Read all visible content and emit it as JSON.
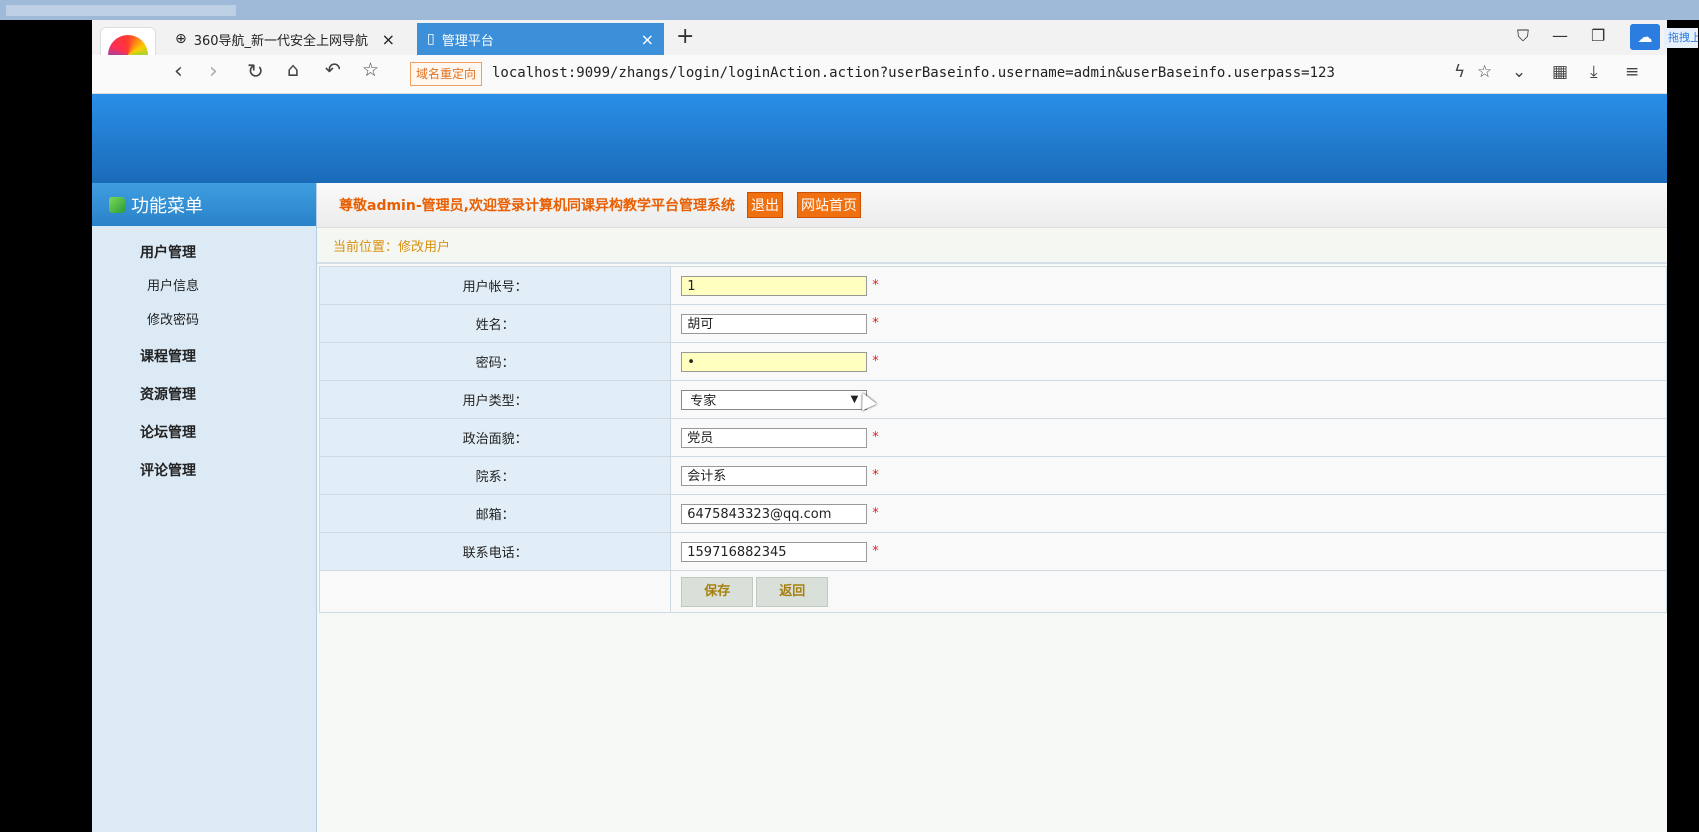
{
  "browser": {
    "tabs": [
      {
        "label": "360导航_新一代安全上网导航",
        "active": false,
        "icon": "shield-icon"
      },
      {
        "label": "管理平台",
        "active": true,
        "icon": "page-icon"
      }
    ],
    "redirect_badge": "域名重定向",
    "url": "localhost:9099/zhangs/login/loginAction.action?userBaseinfo.username=admin&userBaseinfo.userpass=123",
    "drag_hint": "拖拽上传",
    "accent_color": "#3b90d9"
  },
  "sidebar": {
    "title": "功能菜单",
    "items": [
      {
        "label": "用户管理",
        "type": "group"
      },
      {
        "label": "用户信息",
        "type": "sub"
      },
      {
        "label": "修改密码",
        "type": "sub"
      },
      {
        "label": "课程管理",
        "type": "group"
      },
      {
        "label": "资源管理",
        "type": "group"
      },
      {
        "label": "论坛管理",
        "type": "group"
      },
      {
        "label": "评论管理",
        "type": "group"
      }
    ]
  },
  "header": {
    "welcome": "尊敬admin-管理员,欢迎登录计算机同课异构教学平台管理系统",
    "logout_label": "退出",
    "home_label": "网站首页"
  },
  "breadcrumb": "当前位置：修改用户",
  "form": {
    "fields": [
      {
        "label": "用户帐号：",
        "value": "1",
        "required": true,
        "highlight": true
      },
      {
        "label": "姓名：",
        "value": "胡可",
        "required": true,
        "highlight": false
      },
      {
        "label": "密码：",
        "value": "•",
        "required": true,
        "highlight": true
      },
      {
        "label": "用户类型：",
        "value": "专家",
        "type": "select"
      },
      {
        "label": "政治面貌：",
        "value": "党员",
        "required": true,
        "highlight": false
      },
      {
        "label": "院系：",
        "value": "会计系",
        "required": true,
        "highlight": false
      },
      {
        "label": "邮箱：",
        "value": "6475843323@qq.com",
        "required": true,
        "highlight": false
      },
      {
        "label": "联系电话：",
        "value": "159716882345",
        "required": true,
        "highlight": false
      }
    ],
    "required_mark": "*",
    "save_label": "保存",
    "back_label": "返回"
  },
  "colors": {
    "banner": "#2a8fe8",
    "welcome_text": "#e85e00",
    "orange_button": "#f07010",
    "required": "#e02020"
  }
}
